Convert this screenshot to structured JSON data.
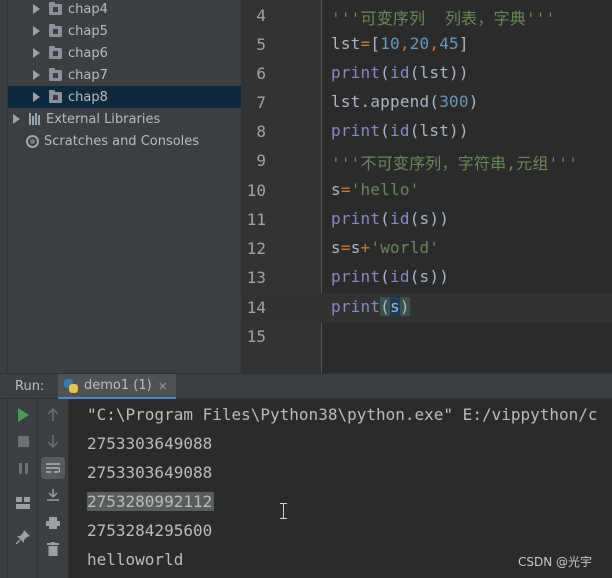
{
  "project_tree": {
    "items": [
      {
        "label": "chap4",
        "kind": "folder",
        "selected": false
      },
      {
        "label": "chap5",
        "kind": "folder",
        "selected": false
      },
      {
        "label": "chap6",
        "kind": "folder",
        "selected": false
      },
      {
        "label": "chap7",
        "kind": "folder",
        "selected": false
      },
      {
        "label": "chap8",
        "kind": "folder",
        "selected": true
      },
      {
        "label": "External Libraries",
        "kind": "libraries",
        "selected": false
      },
      {
        "label": "Scratches and Consoles",
        "kind": "scratches",
        "selected": false
      }
    ]
  },
  "editor": {
    "current_line": 14,
    "lines": [
      {
        "no": "4",
        "code": "'''可变序列  列表，字典'''"
      },
      {
        "no": "5",
        "code": "lst=[10,20,45]"
      },
      {
        "no": "6",
        "code": "print(id(lst))"
      },
      {
        "no": "7",
        "code": "lst.append(300)"
      },
      {
        "no": "8",
        "code": "print(id(lst))"
      },
      {
        "no": "9",
        "code": "'''不可变序列，字符串,元组'''"
      },
      {
        "no": "10",
        "code": "s='hello'"
      },
      {
        "no": "11",
        "code": "print(id(s))"
      },
      {
        "no": "12",
        "code": "s=s+'world'"
      },
      {
        "no": "13",
        "code": "print(id(s))"
      },
      {
        "no": "14",
        "code": "print(s)"
      },
      {
        "no": "15",
        "code": ""
      }
    ]
  },
  "run_panel": {
    "label": "Run:",
    "tab_label": "demo1 (1)",
    "tab_close": "×",
    "output": [
      "\"C:\\Program Files\\Python38\\python.exe\" E:/vippython/c",
      "2753303649088",
      "2753303649088",
      "2753280992112",
      "2753284295600",
      "helloworld"
    ],
    "selected_output_line": 3
  },
  "watermark": "CSDN @光宇",
  "colors": {
    "string": "#6a8759",
    "number": "#6897bb",
    "builtin": "#8888c6",
    "operator": "#cc7832",
    "selection": "#0d293e"
  }
}
